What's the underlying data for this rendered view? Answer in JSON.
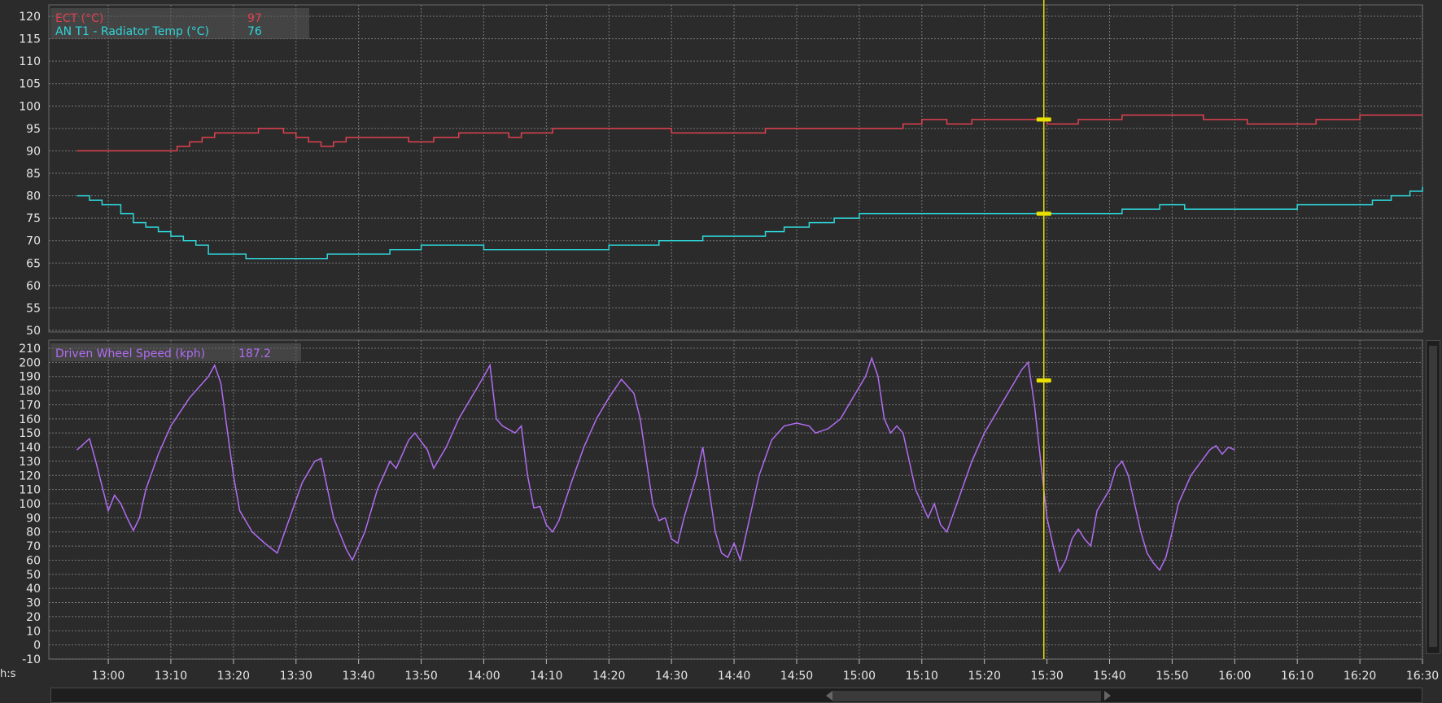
{
  "axis_unit_label": "h:s",
  "colors": {
    "ect": "#e0424f",
    "radiator": "#2fd5d8",
    "speed": "#b06cf0",
    "cursor": "#e8e000",
    "background": "#2b2b2b",
    "grid": "#8a8a8a"
  },
  "chart_data": [
    {
      "type": "line",
      "ylim": [
        50,
        120
      ],
      "yticks": [
        120,
        115,
        110,
        105,
        100,
        95,
        90,
        85,
        80,
        75,
        70,
        65,
        60,
        55,
        50
      ],
      "legend": [
        {
          "label": "ECT (°C)",
          "value": "97"
        },
        {
          "label": "AN T1 - Radiator Temp (°C)",
          "value": "76"
        }
      ],
      "series": [
        {
          "name": "ECT (°C)",
          "points": [
            [
              55,
              90
            ],
            [
              68,
              90
            ],
            [
              71,
              91
            ],
            [
              73,
              92
            ],
            [
              75,
              93
            ],
            [
              77,
              94
            ],
            [
              84,
              95
            ],
            [
              88,
              94
            ],
            [
              90,
              93
            ],
            [
              92,
              92
            ],
            [
              94,
              91
            ],
            [
              96,
              92
            ],
            [
              98,
              93
            ],
            [
              108,
              92
            ],
            [
              112,
              93
            ],
            [
              116,
              94
            ],
            [
              124,
              93
            ],
            [
              126,
              94
            ],
            [
              131,
              95
            ],
            [
              146,
              95
            ],
            [
              150,
              94
            ],
            [
              160,
              94
            ],
            [
              165,
              95
            ],
            [
              185,
              95
            ],
            [
              187,
              96
            ],
            [
              190,
              97
            ],
            [
              194,
              96
            ],
            [
              198,
              97
            ],
            [
              205,
              97
            ],
            [
              210,
              96
            ],
            [
              215,
              97
            ],
            [
              222,
              98
            ],
            [
              230,
              98
            ],
            [
              235,
              97
            ],
            [
              242,
              96
            ],
            [
              250,
              96
            ],
            [
              253,
              97
            ],
            [
              260,
              98
            ],
            [
              270,
              98
            ]
          ],
          "cursor_value": 97
        },
        {
          "name": "AN T1 - Radiator Temp (°C)",
          "points": [
            [
              55,
              80
            ],
            [
              57,
              79
            ],
            [
              59,
              78
            ],
            [
              62,
              76
            ],
            [
              64,
              74
            ],
            [
              66,
              73
            ],
            [
              68,
              72
            ],
            [
              70,
              71
            ],
            [
              72,
              70
            ],
            [
              74,
              69
            ],
            [
              76,
              67
            ],
            [
              80,
              67
            ],
            [
              82,
              66
            ],
            [
              90,
              66
            ],
            [
              95,
              67
            ],
            [
              105,
              68
            ],
            [
              110,
              69
            ],
            [
              120,
              68
            ],
            [
              135,
              68
            ],
            [
              140,
              69
            ],
            [
              148,
              70
            ],
            [
              155,
              71
            ],
            [
              165,
              72
            ],
            [
              168,
              73
            ],
            [
              172,
              74
            ],
            [
              176,
              75
            ],
            [
              180,
              76
            ],
            [
              192,
              76
            ],
            [
              215,
              76
            ],
            [
              222,
              77
            ],
            [
              228,
              78
            ],
            [
              232,
              77
            ],
            [
              245,
              77
            ],
            [
              250,
              78
            ],
            [
              262,
              79
            ],
            [
              265,
              80
            ],
            [
              268,
              81
            ],
            [
              270,
              82
            ]
          ],
          "cursor_value": 76
        }
      ]
    },
    {
      "type": "line",
      "ylim": [
        -10,
        210
      ],
      "yticks": [
        210,
        200,
        190,
        180,
        170,
        160,
        150,
        140,
        130,
        120,
        110,
        100,
        90,
        80,
        70,
        60,
        50,
        40,
        30,
        20,
        10,
        0,
        -10
      ],
      "legend": [
        {
          "label": "Driven Wheel Speed (kph)",
          "value": "187.2"
        }
      ],
      "series": [
        {
          "name": "Driven Wheel Speed (kph)",
          "points": [
            [
              55,
              138
            ],
            [
              57,
              146
            ],
            [
              58,
              130
            ],
            [
              60,
              95
            ],
            [
              61,
              106
            ],
            [
              62,
              100
            ],
            [
              63,
              90
            ],
            [
              64,
              81
            ],
            [
              65,
              90
            ],
            [
              66,
              110
            ],
            [
              68,
              135
            ],
            [
              70,
              155
            ],
            [
              73,
              175
            ],
            [
              76,
              190
            ],
            [
              77,
              198
            ],
            [
              78,
              185
            ],
            [
              80,
              120
            ],
            [
              81,
              95
            ],
            [
              83,
              80
            ],
            [
              85,
              72
            ],
            [
              87,
              65
            ],
            [
              89,
              90
            ],
            [
              91,
              115
            ],
            [
              93,
              130
            ],
            [
              94,
              132
            ],
            [
              96,
              90
            ],
            [
              98,
              68
            ],
            [
              99,
              60
            ],
            [
              101,
              80
            ],
            [
              103,
              110
            ],
            [
              105,
              130
            ],
            [
              106,
              125
            ],
            [
              108,
              145
            ],
            [
              109,
              150
            ],
            [
              111,
              138
            ],
            [
              112,
              125
            ],
            [
              114,
              140
            ],
            [
              116,
              160
            ],
            [
              118,
              175
            ],
            [
              120,
              190
            ],
            [
              121,
              198
            ],
            [
              122,
              160
            ],
            [
              123,
              155
            ],
            [
              125,
              150
            ],
            [
              126,
              155
            ],
            [
              127,
              120
            ],
            [
              128,
              97
            ],
            [
              129,
              98
            ],
            [
              130,
              85
            ],
            [
              131,
              80
            ],
            [
              132,
              88
            ],
            [
              134,
              115
            ],
            [
              136,
              140
            ],
            [
              138,
              160
            ],
            [
              140,
              175
            ],
            [
              142,
              188
            ],
            [
              143,
              183
            ],
            [
              144,
              178
            ],
            [
              145,
              160
            ],
            [
              146,
              130
            ],
            [
              147,
              100
            ],
            [
              148,
              88
            ],
            [
              149,
              90
            ],
            [
              150,
              75
            ],
            [
              151,
              72
            ],
            [
              152,
              90
            ],
            [
              154,
              120
            ],
            [
              155,
              140
            ],
            [
              156,
              110
            ],
            [
              157,
              80
            ],
            [
              158,
              65
            ],
            [
              159,
              62
            ],
            [
              160,
              72
            ],
            [
              161,
              60
            ],
            [
              162,
              80
            ],
            [
              164,
              120
            ],
            [
              166,
              145
            ],
            [
              168,
              155
            ],
            [
              170,
              157
            ],
            [
              172,
              155
            ],
            [
              173,
              150
            ],
            [
              175,
              153
            ],
            [
              177,
              160
            ],
            [
              179,
              175
            ],
            [
              181,
              190
            ],
            [
              182,
              203
            ],
            [
              183,
              190
            ],
            [
              184,
              160
            ],
            [
              185,
              150
            ],
            [
              186,
              155
            ],
            [
              187,
              150
            ],
            [
              189,
              110
            ],
            [
              190,
              100
            ],
            [
              191,
              90
            ],
            [
              192,
              100
            ],
            [
              193,
              85
            ],
            [
              194,
              80
            ],
            [
              196,
              105
            ],
            [
              198,
              130
            ],
            [
              200,
              150
            ],
            [
              202,
              165
            ],
            [
              204,
              180
            ],
            [
              206,
              195
            ],
            [
              207,
              200
            ],
            [
              208,
              170
            ],
            [
              209,
              130
            ],
            [
              210,
              90
            ],
            [
              211,
              70
            ],
            [
              212,
              52
            ],
            [
              213,
              60
            ],
            [
              214,
              75
            ],
            [
              215,
              82
            ],
            [
              216,
              75
            ],
            [
              217,
              70
            ],
            [
              218,
              95
            ],
            [
              220,
              110
            ],
            [
              221,
              125
            ],
            [
              222,
              130
            ],
            [
              223,
              120
            ],
            [
              224,
              100
            ],
            [
              225,
              80
            ],
            [
              226,
              65
            ],
            [
              227,
              58
            ],
            [
              228,
              53
            ],
            [
              229,
              62
            ],
            [
              230,
              80
            ],
            [
              231,
              100
            ],
            [
              233,
              120
            ],
            [
              235,
              132
            ],
            [
              236,
              138
            ],
            [
              237,
              141
            ],
            [
              238,
              135
            ],
            [
              239,
              140
            ],
            [
              240,
              138
            ]
          ],
          "cursor_value": 187.2
        }
      ]
    }
  ],
  "xaxis": {
    "unit": "minutes since 12:00",
    "range": [
      50.5,
      270
    ],
    "tick_labels": [
      "13:00",
      "13:10",
      "13:20",
      "13:30",
      "13:40",
      "13:50",
      "14:00",
      "14:10",
      "14:20",
      "14:30",
      "14:40",
      "14:50",
      "15:00",
      "15:10",
      "15:20",
      "15:30",
      "15:40",
      "15:50",
      "16:00",
      "16:10",
      "16:20",
      "16:30"
    ],
    "tick_values": [
      60,
      70,
      80,
      90,
      100,
      110,
      120,
      130,
      140,
      150,
      160,
      170,
      180,
      190,
      200,
      210,
      220,
      230,
      240,
      250,
      260,
      270
    ],
    "cursor_time": 209.5
  }
}
